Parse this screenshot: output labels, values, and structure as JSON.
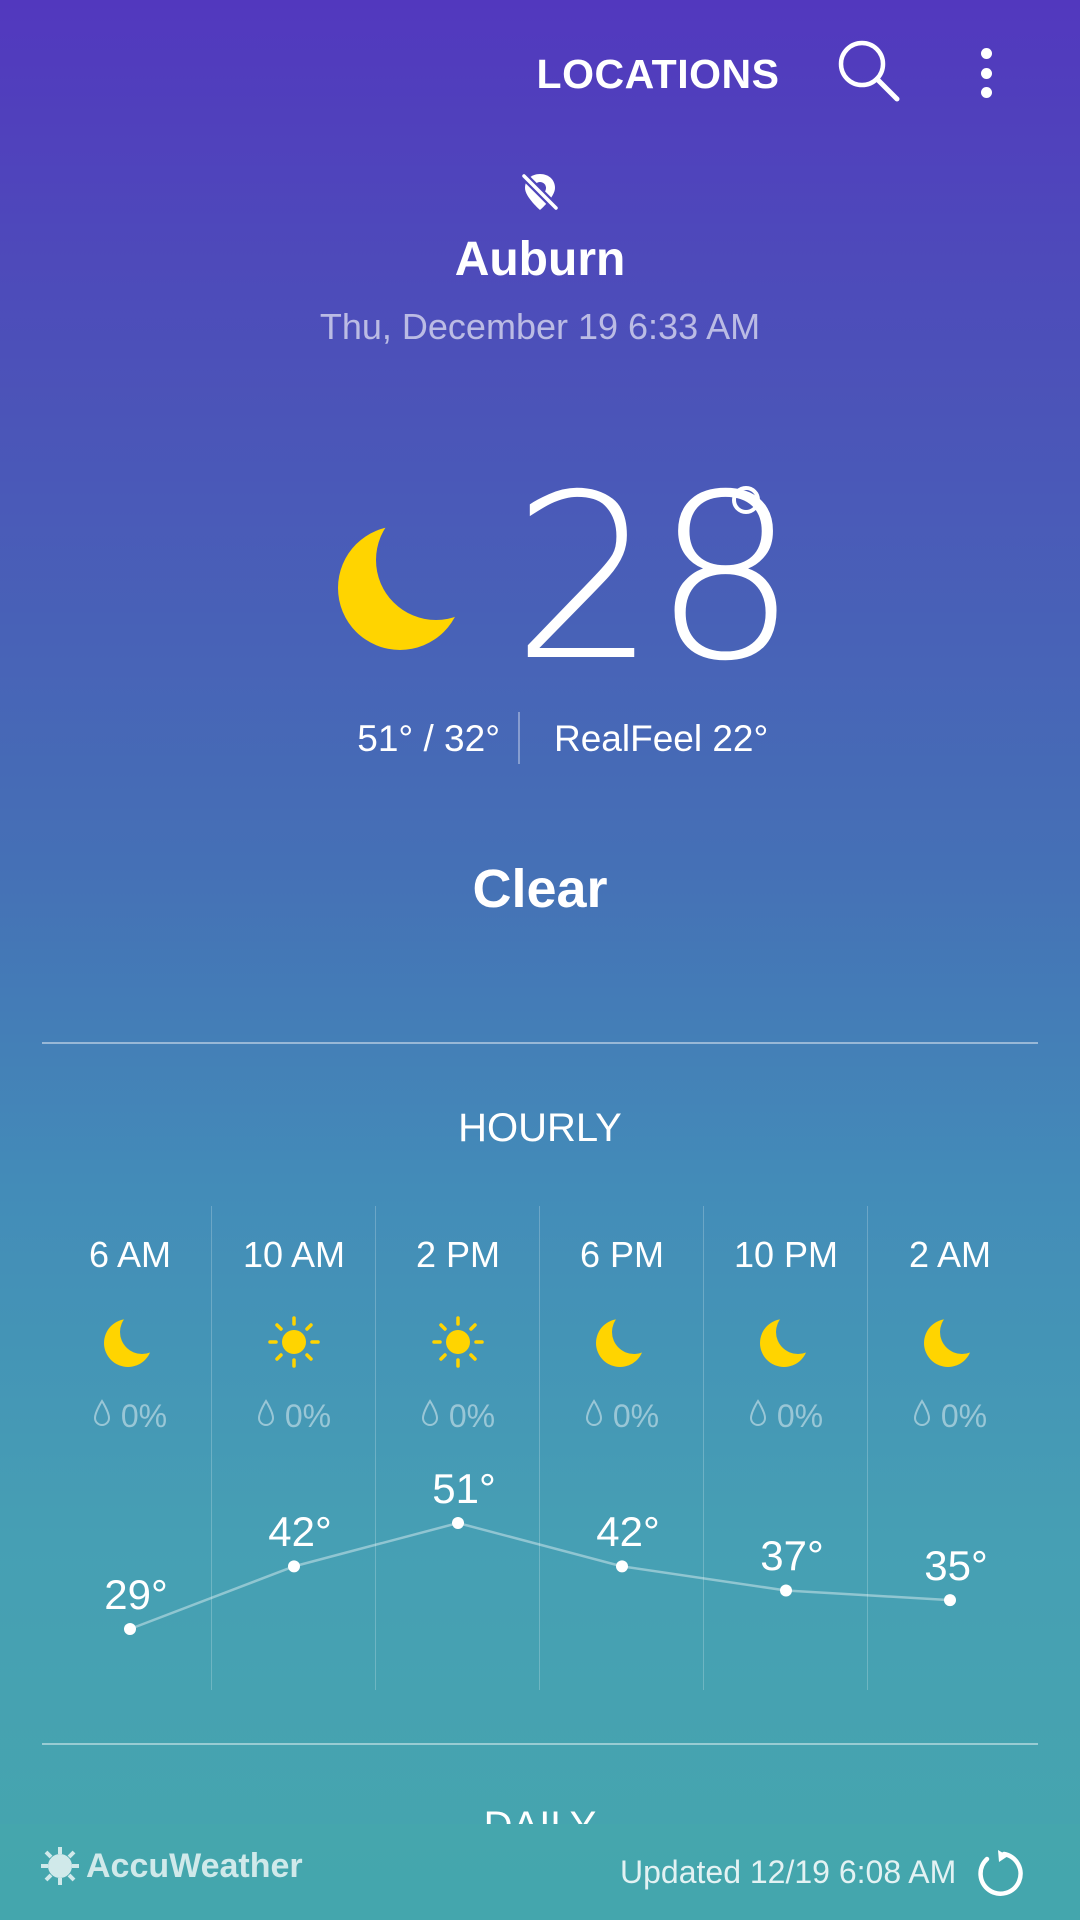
{
  "topbar": {
    "locations_label": "LOCATIONS",
    "search_icon": "search-icon",
    "more_icon": "more-vert-icon"
  },
  "current": {
    "location_status_icon": "location-off-icon",
    "city": "Auburn",
    "datetime": "Thu, December 19 6:33 AM",
    "condition_icon": "moon-icon",
    "temperature": "28",
    "hi_lo": "51°  /  32°",
    "realfeel": "RealFeel 22°",
    "condition": "Clear"
  },
  "hourly": {
    "title": "HOURLY",
    "items": [
      {
        "time": "6 AM",
        "icon": "moon-icon",
        "precip": "0%",
        "temp": "29°",
        "value": 29
      },
      {
        "time": "10 AM",
        "icon": "sun-icon",
        "precip": "0%",
        "temp": "42°",
        "value": 42
      },
      {
        "time": "2 PM",
        "icon": "sun-icon",
        "precip": "0%",
        "temp": "51°",
        "value": 51
      },
      {
        "time": "6 PM",
        "icon": "moon-icon",
        "precip": "0%",
        "temp": "42°",
        "value": 42
      },
      {
        "time": "10 PM",
        "icon": "moon-icon",
        "precip": "0%",
        "temp": "37°",
        "value": 37
      },
      {
        "time": "2 AM",
        "icon": "moon-icon",
        "precip": "0%",
        "temp": "35°",
        "value": 35
      }
    ]
  },
  "daily": {
    "title": "DAILY"
  },
  "footer": {
    "brand": "AccuWeather",
    "updated": "Updated  12/19  6:08 AM",
    "refresh_icon": "refresh-icon"
  },
  "colors": {
    "accent_yellow": "#FFD400",
    "gradient_top": "#5238be",
    "gradient_bottom": "#45a6ad"
  }
}
